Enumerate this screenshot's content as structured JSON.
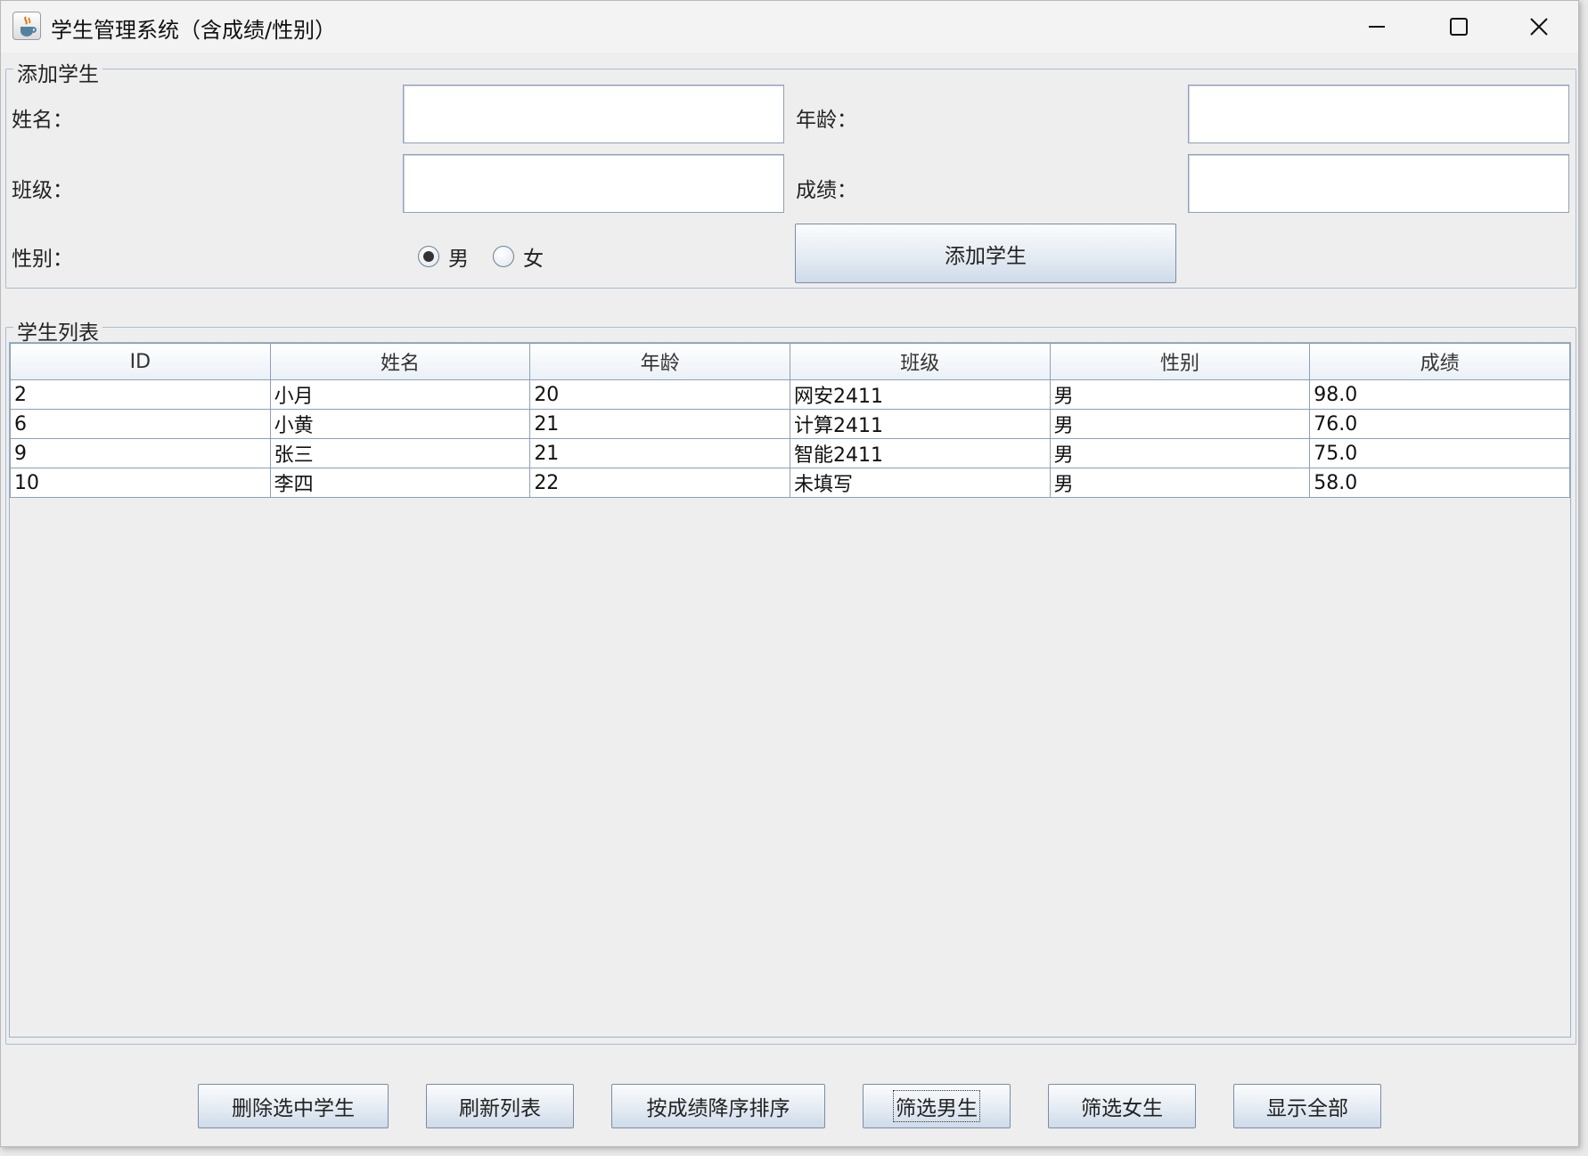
{
  "window": {
    "title": "学生管理系统（含成绩/性别）",
    "controls": {
      "minimize": "—",
      "maximize": "☐",
      "close": "✕"
    }
  },
  "add_section": {
    "legend": "添加学生",
    "name_label": "姓名：",
    "name_value": "",
    "age_label": "年龄：",
    "age_value": "",
    "class_label": "班级：",
    "class_value": "",
    "score_label": "成绩：",
    "score_value": "",
    "gender_label": "性别：",
    "gender_options": [
      {
        "label": "男",
        "selected": true
      },
      {
        "label": "女",
        "selected": false
      }
    ],
    "add_button": "添加学生"
  },
  "list_section": {
    "legend": "学生列表",
    "columns": [
      "ID",
      "姓名",
      "年龄",
      "班级",
      "性别",
      "成绩"
    ],
    "rows": [
      [
        "2",
        "小月",
        "20",
        "网安2411",
        "男",
        "98.0"
      ],
      [
        "6",
        "小黄",
        "21",
        "计算2411",
        "男",
        "76.0"
      ],
      [
        "9",
        "张三",
        "21",
        "智能2411",
        "男",
        "75.0"
      ],
      [
        "10",
        "李四",
        "22",
        "未填写",
        "男",
        "58.0"
      ]
    ]
  },
  "actions": {
    "delete": "删除选中学生",
    "refresh": "刷新列表",
    "sort_desc": "按成绩降序排序",
    "filter_male": "筛选男生",
    "filter_female": "筛选女生",
    "show_all": "显示全部"
  },
  "colors": {
    "accent_border": "#a9bdd6",
    "button_gradient_top": "#fbfcfd",
    "button_gradient_bottom": "#cfdbe9"
  },
  "icons": {
    "app": "java-cup-icon"
  }
}
